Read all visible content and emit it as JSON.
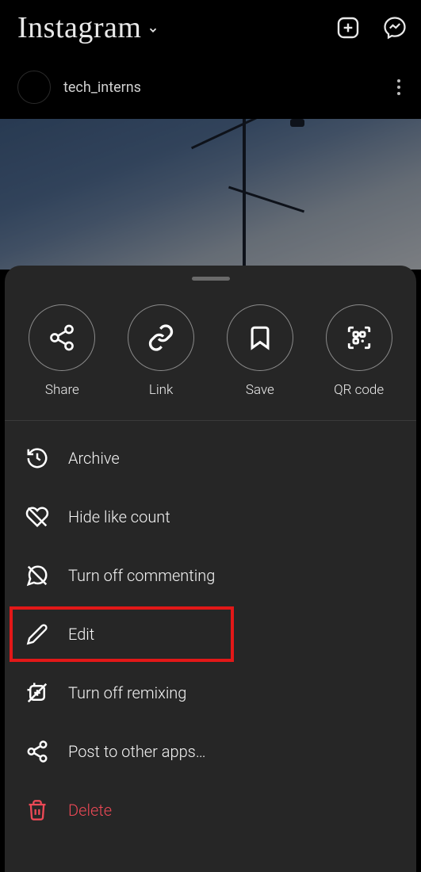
{
  "header": {
    "logo": "Instagram"
  },
  "post": {
    "username": "tech_interns"
  },
  "sheet": {
    "actions": {
      "share": "Share",
      "link": "Link",
      "save": "Save",
      "qrcode": "QR code"
    },
    "menu": {
      "archive": "Archive",
      "hide_likes": "Hide like count",
      "turn_off_commenting": "Turn off commenting",
      "edit": "Edit",
      "turn_off_remixing": "Turn off remixing",
      "post_to_other": "Post to other apps…",
      "delete": "Delete"
    }
  }
}
